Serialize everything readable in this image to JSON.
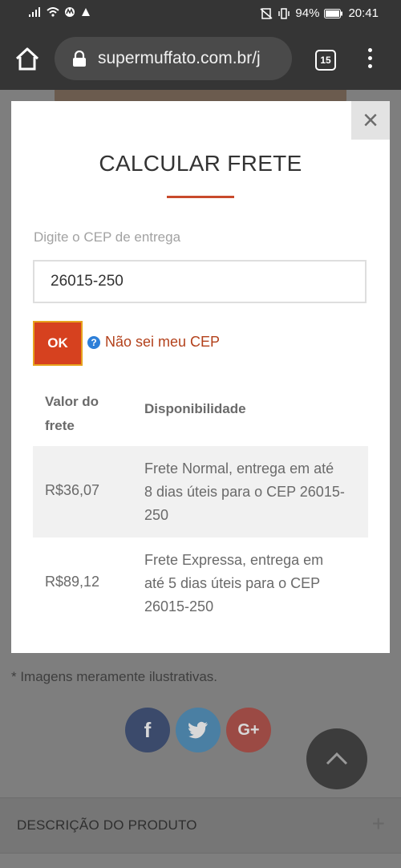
{
  "status": {
    "signal": "signal",
    "battery": "94%",
    "time": "20:41"
  },
  "browser": {
    "url": "supermuffato.com.br/j",
    "tab_count": "15"
  },
  "modal": {
    "title": "CALCULAR FRETE",
    "close_label": "×",
    "cep_label": "Digite o CEP de entrega",
    "cep_value": "26015-250",
    "ok_label": "OK",
    "help_icon": "?",
    "help_link": "Não sei meu CEP",
    "table": {
      "header_value": "Valor do frete",
      "header_availability": "Disponibilidade",
      "rows": [
        {
          "price": "R$36,07",
          "desc": "Frete Normal, entrega em até 8 dias úteis para o CEP 26015-250"
        },
        {
          "price": "R$89,12",
          "desc": "Frete Expressa, entrega em até 5 dias úteis para o CEP 26015-250"
        }
      ]
    }
  },
  "page": {
    "disclaimer": "* Imagens meramente ilustrativas.",
    "social": {
      "facebook": "f",
      "twitter": "t",
      "gplus": "G+"
    },
    "description_title": "DESCRIÇÃO DO PRODUTO",
    "description_toggle": "+"
  },
  "colors": {
    "accent": "#d6411f",
    "link": "#b3411b",
    "rule": "#c84a2c"
  }
}
